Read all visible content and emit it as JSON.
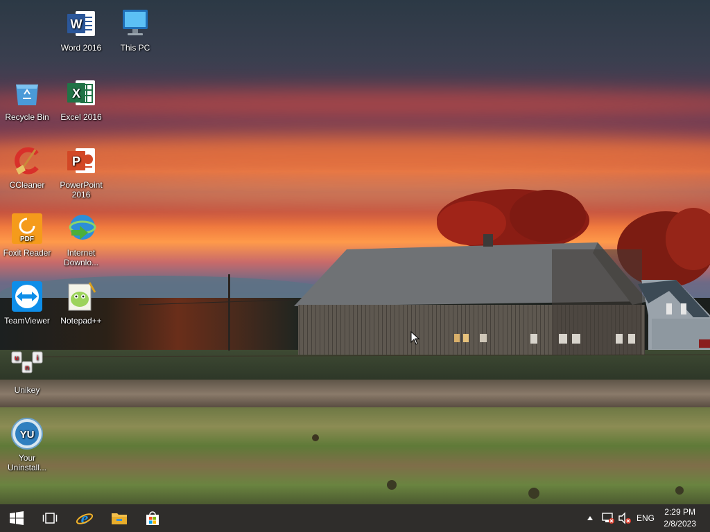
{
  "desktop": {
    "icons": [
      {
        "id": "word",
        "label": "Word 2016",
        "icon": "word-icon"
      },
      {
        "id": "thispc",
        "label": "This PC",
        "icon": "computer-icon"
      },
      {
        "id": "recycle",
        "label": "Recycle Bin",
        "icon": "recycle-bin-icon"
      },
      {
        "id": "excel",
        "label": "Excel 2016",
        "icon": "excel-icon"
      },
      {
        "id": "ccleaner",
        "label": "CCleaner",
        "icon": "ccleaner-icon"
      },
      {
        "id": "powerpoint",
        "label": "PowerPoint 2016",
        "icon": "powerpoint-icon"
      },
      {
        "id": "foxit",
        "label": "Foxit Reader",
        "icon": "foxit-pdf-icon"
      },
      {
        "id": "idm",
        "label": "Internet Downlo...",
        "icon": "internet-download-manager-icon"
      },
      {
        "id": "teamviewer",
        "label": "TeamViewer",
        "icon": "teamviewer-icon"
      },
      {
        "id": "notepadpp",
        "label": "Notepad++",
        "icon": "notepad-plus-plus-icon"
      },
      {
        "id": "unikey",
        "label": "Unikey",
        "icon": "unikey-icon"
      },
      {
        "id": "uninstaller",
        "label": "Your Uninstall...",
        "icon": "your-uninstaller-icon"
      }
    ]
  },
  "taskbar": {
    "start": "windows-start-icon",
    "task_view": "task-view-icon",
    "pinned": [
      "internet-explorer-icon",
      "file-explorer-icon",
      "store-icon"
    ],
    "tray": {
      "chevron": "show-hidden-icons",
      "network": "network-disconnected-icon",
      "volume": "volume-muted-icon",
      "language": "ENG",
      "time": "2:29 PM",
      "date": "2/8/2023"
    }
  },
  "colors": {
    "word": "#2b579a",
    "excel": "#217346",
    "powerpoint": "#d24726",
    "teamviewer": "#0e8ee9",
    "foxit": "#f59b1b",
    "taskbar": "#12100e"
  }
}
